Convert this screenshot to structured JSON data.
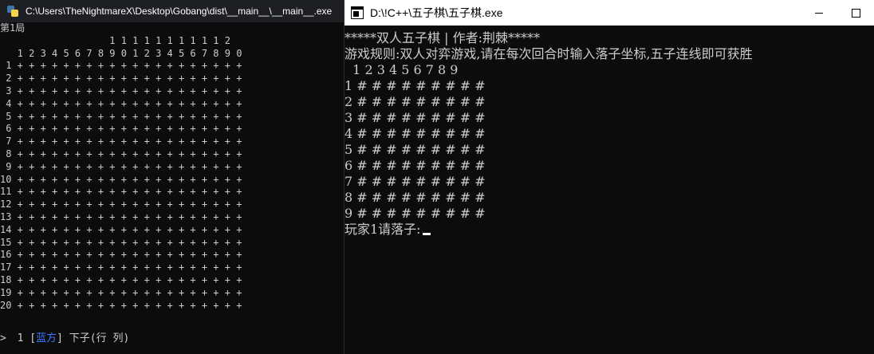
{
  "left_window": {
    "title": "C:\\Users\\TheNightmareX\\Desktop\\Gobang\\dist\\__main__\\__main__.exe",
    "lines": [
      "第1局",
      "                   1 1 1 1 1 1 1 1 1 1 2",
      "   1 2 3 4 5 6 7 8 9 0 1 2 3 4 5 6 7 8 9 0",
      " 1 + + + + + + + + + + + + + + + + + + + +",
      " 2 + + + + + + + + + + + + + + + + + + + +",
      " 3 + + + + + + + + + + + + + + + + + + + +",
      " 4 + + + + + + + + + + + + + + + + + + + +",
      " 5 + + + + + + + + + + + + + + + + + + + +",
      " 6 + + + + + + + + + + + + + + + + + + + +",
      " 7 + + + + + + + + + + + + + + + + + + + +",
      " 8 + + + + + + + + + + + + + + + + + + + +",
      " 9 + + + + + + + + + + + + + + + + + + + +",
      "10 + + + + + + + + + + + + + + + + + + + +",
      "11 + + + + + + + + + + + + + + + + + + + +",
      "12 + + + + + + + + + + + + + + + + + + + +",
      "13 + + + + + + + + + + + + + + + + + + + +",
      "14 + + + + + + + + + + + + + + + + + + + +",
      "15 + + + + + + + + + + + + + + + + + + + +",
      "16 + + + + + + + + + + + + + + + + + + + +",
      "17 + + + + + + + + + + + + + + + + + + + +",
      "18 + + + + + + + + + + + + + + + + + + + +",
      "19 + + + + + + + + + + + + + + + + + + + +",
      "20 + + + + + + + + + + + + + + + + + + + +"
    ],
    "prompt": {
      "arrow": ">",
      "number": " 1 [",
      "side": "蓝方",
      "rest": "] 下子(行 列)"
    }
  },
  "right_window": {
    "title": "D:\\!C++\\五子棋\\五子棋.exe",
    "lines": [
      "*****双人五子棋 | 作者:荆棘*****",
      "游戏规则:双人对弈游戏,请在每次回合时输入落子坐标,五子连线即可获胜",
      "  1 2 3 4 5 6 7 8 9",
      "1 # # # # # # # # #",
      "2 # # # # # # # # #",
      "3 # # # # # # # # #",
      "4 # # # # # # # # #",
      "5 # # # # # # # # #",
      "6 # # # # # # # # #",
      "7 # # # # # # # # #",
      "8 # # # # # # # # #",
      "9 # # # # # # # # #"
    ],
    "input_prompt": "玩家1请落子:"
  },
  "colors": {
    "terminal_bg": "#0c0c0c",
    "terminal_text": "#cccccc",
    "highlight_blue": "#3b78ff"
  }
}
